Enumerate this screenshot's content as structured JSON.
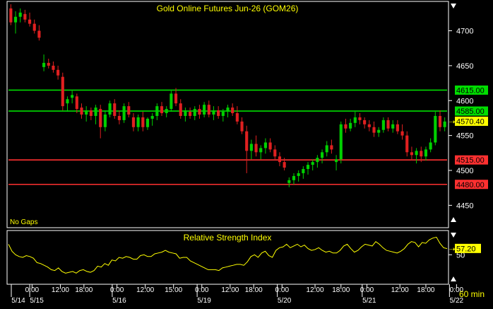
{
  "chart_data": [
    {
      "type": "candlestick",
      "title": "Gold Online Futures Jun-26 (GOM26)",
      "note": "No Gaps",
      "interval_label": "60 min",
      "ylim": [
        4420,
        4740
      ],
      "y_ticks": [
        4450,
        4500,
        4550,
        4600,
        4650,
        4700
      ],
      "last_price": "4570.40",
      "grid": false,
      "colors": {
        "up": "#00d000",
        "down": "#e02020",
        "text": "#ffff00",
        "axis": "#ffffff",
        "support": "#ff3030",
        "resistance": "#00dd00",
        "price_tag": "#ffff00"
      },
      "levels": [
        {
          "value": 4615,
          "label": "4615.00",
          "kind": "resistance"
        },
        {
          "value": 4585,
          "label": "4585.00",
          "kind": "resistance"
        },
        {
          "value": 4515,
          "label": "4515.00",
          "kind": "support"
        },
        {
          "value": 4480,
          "label": "4480.00",
          "kind": "support"
        }
      ],
      "candles": [
        [
          4732,
          4738,
          4708,
          4712
        ],
        [
          4712,
          4728,
          4696,
          4720
        ],
        [
          4720,
          4732,
          4712,
          4726
        ],
        [
          4724,
          4730,
          4712,
          4716
        ],
        [
          4716,
          4726,
          4706,
          4710
        ],
        [
          4710,
          4716,
          4696,
          4700
        ],
        [
          4700,
          4708,
          4686,
          4690
        ],
        [
          4648,
          4666,
          4642,
          4654
        ],
        [
          4654,
          4660,
          4646,
          4650
        ],
        [
          4650,
          4656,
          4640,
          4644
        ],
        [
          4644,
          4650,
          4630,
          4636
        ],
        [
          4634,
          4640,
          4586,
          4592
        ],
        [
          4596,
          4606,
          4584,
          4602
        ],
        [
          4604,
          4614,
          4596,
          4608
        ],
        [
          4606,
          4610,
          4582,
          4588
        ],
        [
          4590,
          4596,
          4574,
          4580
        ],
        [
          4580,
          4592,
          4570,
          4586
        ],
        [
          4586,
          4590,
          4572,
          4578
        ],
        [
          4578,
          4594,
          4566,
          4590
        ],
        [
          4588,
          4594,
          4546,
          4562
        ],
        [
          4562,
          4586,
          4556,
          4580
        ],
        [
          4580,
          4600,
          4576,
          4596
        ],
        [
          4596,
          4602,
          4574,
          4578
        ],
        [
          4578,
          4586,
          4566,
          4572
        ],
        [
          4572,
          4596,
          4568,
          4592
        ],
        [
          4592,
          4598,
          4576,
          4580
        ],
        [
          4576,
          4582,
          4556,
          4562
        ],
        [
          4562,
          4580,
          4556,
          4576
        ],
        [
          4576,
          4584,
          4556,
          4562
        ],
        [
          4562,
          4576,
          4558,
          4574
        ],
        [
          4574,
          4582,
          4564,
          4578
        ],
        [
          4578,
          4596,
          4572,
          4592
        ],
        [
          4592,
          4598,
          4578,
          4582
        ],
        [
          4582,
          4592,
          4576,
          4588
        ],
        [
          4588,
          4614,
          4584,
          4610
        ],
        [
          4610,
          4618,
          4592,
          4596
        ],
        [
          4596,
          4602,
          4574,
          4578
        ],
        [
          4578,
          4590,
          4570,
          4586
        ],
        [
          4584,
          4590,
          4574,
          4578
        ],
        [
          4578,
          4592,
          4572,
          4588
        ],
        [
          4588,
          4594,
          4574,
          4580
        ],
        [
          4580,
          4598,
          4576,
          4594
        ],
        [
          4594,
          4600,
          4576,
          4580
        ],
        [
          4580,
          4592,
          4572,
          4586
        ],
        [
          4586,
          4592,
          4574,
          4578
        ],
        [
          4578,
          4588,
          4570,
          4584
        ],
        [
          4584,
          4594,
          4576,
          4590
        ],
        [
          4590,
          4596,
          4578,
          4582
        ],
        [
          4582,
          4592,
          4566,
          4570
        ],
        [
          4570,
          4576,
          4552,
          4556
        ],
        [
          4556,
          4564,
          4496,
          4528
        ],
        [
          4528,
          4544,
          4516,
          4538
        ],
        [
          4538,
          4550,
          4520,
          4526
        ],
        [
          4526,
          4536,
          4516,
          4532
        ],
        [
          4532,
          4546,
          4524,
          4540
        ],
        [
          4540,
          4546,
          4526,
          4530
        ],
        [
          4530,
          4536,
          4516,
          4520
        ],
        [
          4520,
          4526,
          4506,
          4512
        ],
        [
          4512,
          4518,
          4500,
          4504
        ],
        [
          4482,
          4490,
          4476,
          4486
        ],
        [
          4486,
          4496,
          4480,
          4492
        ],
        [
          4492,
          4500,
          4484,
          4496
        ],
        [
          4496,
          4506,
          4488,
          4502
        ],
        [
          4502,
          4512,
          4494,
          4508
        ],
        [
          4508,
          4516,
          4500,
          4512
        ],
        [
          4512,
          4522,
          4504,
          4518
        ],
        [
          4518,
          4530,
          4510,
          4526
        ],
        [
          4526,
          4542,
          4520,
          4536
        ],
        [
          4536,
          4544,
          4524,
          4530
        ],
        [
          4512,
          4522,
          4500,
          4516
        ],
        [
          4516,
          4570,
          4510,
          4566
        ],
        [
          4566,
          4574,
          4554,
          4560
        ],
        [
          4560,
          4574,
          4556,
          4568
        ],
        [
          4568,
          4584,
          4562,
          4576
        ],
        [
          4576,
          4582,
          4566,
          4572
        ],
        [
          4572,
          4576,
          4560,
          4566
        ],
        [
          4566,
          4572,
          4556,
          4562
        ],
        [
          4562,
          4570,
          4548,
          4554
        ],
        [
          4554,
          4562,
          4548,
          4558
        ],
        [
          4558,
          4576,
          4554,
          4572
        ],
        [
          4572,
          4576,
          4556,
          4560
        ],
        [
          4560,
          4572,
          4554,
          4566
        ],
        [
          4566,
          4572,
          4552,
          4556
        ],
        [
          4556,
          4566,
          4544,
          4550
        ],
        [
          4550,
          4556,
          4520,
          4526
        ],
        [
          4526,
          4534,
          4514,
          4522
        ],
        [
          4522,
          4532,
          4510,
          4528
        ],
        [
          4528,
          4534,
          4512,
          4520
        ],
        [
          4520,
          4534,
          4514,
          4530
        ],
        [
          4530,
          4546,
          4526,
          4540
        ],
        [
          4540,
          4584,
          4536,
          4578
        ],
        [
          4578,
          4586,
          4556,
          4562
        ],
        [
          4562,
          4576,
          4556,
          4570
        ]
      ],
      "x_time_labels": [
        {
          "bar": 4.5,
          "label": "0:00"
        },
        {
          "bar": 10.5,
          "label": "12:00"
        },
        {
          "bar": 15.5,
          "label": "18:00"
        },
        {
          "bar": 22.5,
          "label": "0:00"
        },
        {
          "bar": 28.5,
          "label": "12:00"
        },
        {
          "bar": 34.5,
          "label": "15:00"
        },
        {
          "bar": 40.5,
          "label": "0:00"
        },
        {
          "bar": 46.5,
          "label": "12:00"
        },
        {
          "bar": 51.5,
          "label": "18:00"
        },
        {
          "bar": 57.5,
          "label": "0:00"
        },
        {
          "bar": 64.5,
          "label": "12:00"
        },
        {
          "bar": 70,
          "label": "18:00"
        },
        {
          "bar": 75.5,
          "label": "0:00"
        },
        {
          "bar": 82.5,
          "label": "12:00"
        },
        {
          "bar": 88,
          "label": "18:00"
        },
        {
          "bar": 94.5,
          "label": "0:00"
        }
      ],
      "x_date_labels": [
        {
          "bar": 0,
          "label": "5/14"
        },
        {
          "bar": 5.5,
          "label": "5/15"
        },
        {
          "bar": 23,
          "label": "5/16"
        },
        {
          "bar": 41,
          "label": "5/19"
        },
        {
          "bar": 58,
          "label": "5/20"
        },
        {
          "bar": 76,
          "label": "5/21"
        },
        {
          "bar": 94.5,
          "label": "5/22"
        }
      ]
    },
    {
      "type": "line",
      "title": "Relative Strength Index",
      "ylim": [
        18,
        76
      ],
      "y_ticks": [
        50
      ],
      "last_value": "57.20",
      "colors": {
        "line": "#ffff00",
        "text": "#ffff00",
        "axis": "#ffffff",
        "tag": "#ffff00"
      },
      "values": [
        62,
        54,
        50,
        48,
        47,
        49,
        48,
        46,
        41,
        40,
        38,
        36,
        33,
        32,
        35,
        31,
        29,
        30,
        31,
        29,
        32,
        33,
        31,
        30,
        32,
        37,
        36,
        40,
        38,
        44,
        43,
        47,
        46,
        48,
        47,
        45,
        45,
        49,
        50,
        48,
        48,
        51,
        52,
        53,
        55,
        53,
        52,
        51,
        46,
        47,
        47,
        43,
        41,
        39,
        37,
        35,
        33,
        33,
        33,
        32,
        35,
        36,
        37,
        38,
        39,
        39,
        38,
        42,
        48,
        50,
        47,
        52,
        54,
        49,
        47,
        55,
        58,
        59,
        62,
        58,
        60,
        62,
        59,
        61,
        57,
        55,
        56,
        58,
        55,
        53,
        54,
        52,
        52,
        55,
        60,
        62,
        57,
        53,
        55,
        59,
        62,
        61,
        60,
        65,
        62,
        58,
        55,
        54,
        53,
        52,
        54,
        57,
        62,
        65,
        64,
        59,
        64,
        63,
        67,
        69,
        70,
        63,
        58,
        57
      ]
    }
  ]
}
